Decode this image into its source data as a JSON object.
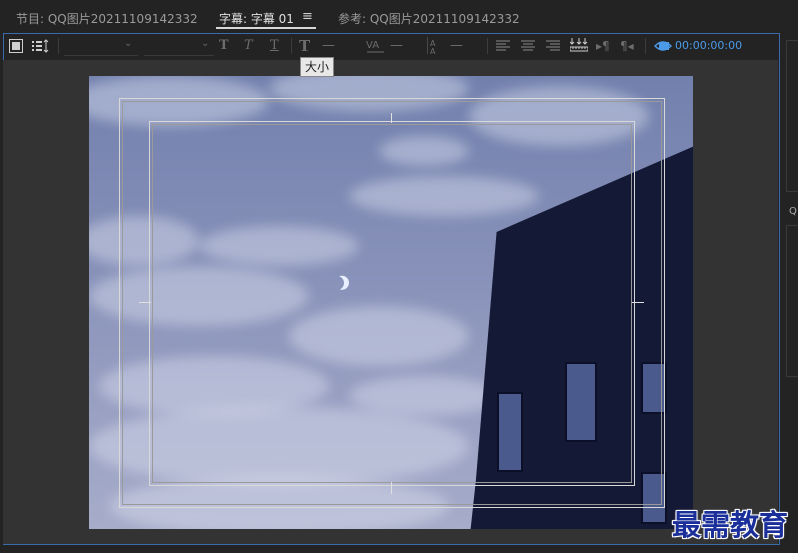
{
  "tabs": {
    "program": "节目: QQ图片20211109142332",
    "captions": "字幕: 字幕 01",
    "reference": "参考: QQ图片20211109142332",
    "menu_symbol": "≡"
  },
  "toolbar": {
    "font_family_value": "",
    "font_style_value": "",
    "dash_1": "—",
    "dash_2": "—",
    "dash_3": "—",
    "timecode": "00:00:00:00"
  },
  "tooltip": {
    "text": "大小"
  },
  "right_panel": {
    "label": "Q"
  },
  "watermark": {
    "text": "最需教育"
  },
  "colors": {
    "accent": "#4a9ae8",
    "panel_border": "#3b6aa8",
    "watermark": "#1b2f9a"
  },
  "icons": [
    "film-icon",
    "timeline-icon",
    "bold-icon",
    "italic-icon",
    "small-caps-icon",
    "text-size-icon",
    "kerning-icon",
    "leading-icon",
    "align-left-icon",
    "align-center-icon",
    "align-right-icon",
    "tab-stops-icon",
    "paragraph-ltr-icon",
    "paragraph-rtl-icon",
    "show-video-icon"
  ]
}
